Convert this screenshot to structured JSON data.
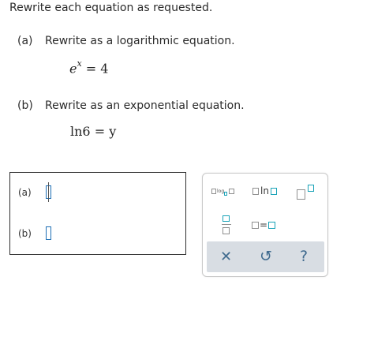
{
  "question": {
    "prompt": "Rewrite each equation as requested.",
    "parts": [
      {
        "label": "(a)",
        "instruction": "Rewrite as a logarithmic equation.",
        "equation": {
          "base": "e",
          "exponent": "x",
          "rhs": "= 4"
        }
      },
      {
        "label": "(b)",
        "instruction": "Rewrite as an exponential equation.",
        "equation": {
          "func": "ln",
          "arg": "6",
          "rhs": "= y"
        }
      }
    ]
  },
  "answer_box": {
    "rows": [
      {
        "label": "(a)"
      },
      {
        "label": "(b)"
      }
    ]
  },
  "palette": {
    "log_text": "log",
    "ln_text": "ln",
    "equals_text": "=",
    "actions": {
      "clear_icon": "✕",
      "undo_icon": "↺",
      "help_icon": "?"
    },
    "colors": {
      "accent": "#1aa3b8",
      "slot": "#1e6fb5",
      "bar": "#d8dde3"
    }
  }
}
